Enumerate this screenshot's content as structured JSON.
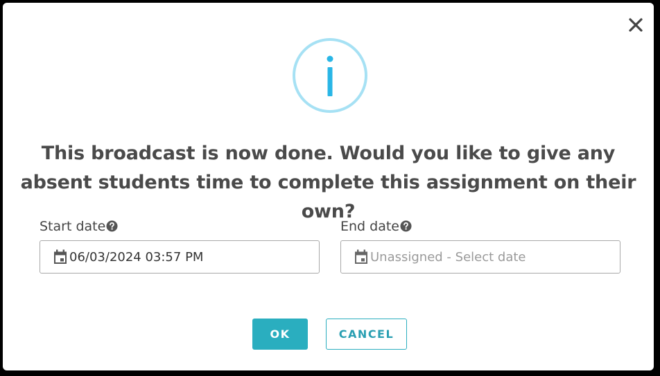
{
  "dialog": {
    "message": "This broadcast is now done. Would you like to give any absent students time to complete this assignment on their own?",
    "start_date": {
      "label": "Start date",
      "value": "06/03/2024 03:57 PM"
    },
    "end_date": {
      "label": "End date",
      "placeholder": "Unassigned - Select date"
    },
    "buttons": {
      "ok": "OK",
      "cancel": "CANCEL"
    }
  },
  "icons": {
    "close": "close-icon",
    "info": "info-icon",
    "help": "help-icon",
    "calendar": "calendar-icon"
  },
  "colors": {
    "accent": "#2aaebf",
    "info_circle": "#a6e1f4",
    "info_glyph": "#29b6e6",
    "text": "#4a4a4a"
  }
}
